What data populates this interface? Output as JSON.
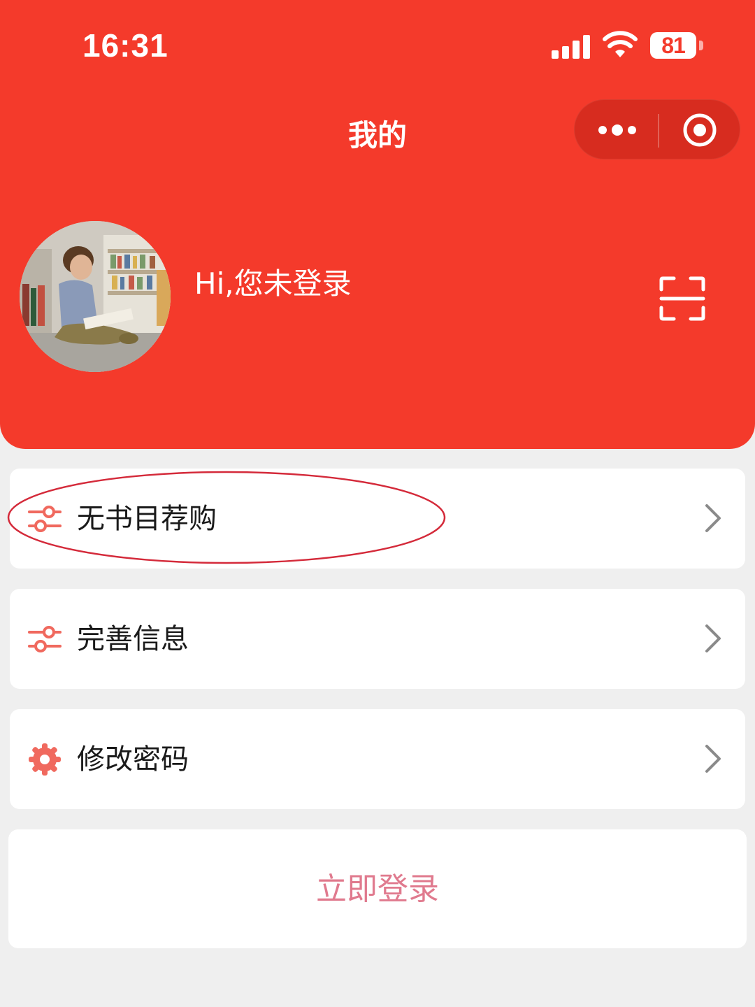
{
  "status_bar": {
    "time": "16:31",
    "battery": "81"
  },
  "nav": {
    "title": "我的",
    "more_icon": "more-dots-icon",
    "close_icon": "target-close-icon"
  },
  "profile": {
    "greeting": "Hi,您未登录",
    "avatar": "boy-reading-in-library",
    "scan_icon": "scan-icon"
  },
  "menu": [
    {
      "label": "无书目荐购",
      "icon": "sliders-icon"
    },
    {
      "label": "完善信息",
      "icon": "sliders-icon"
    },
    {
      "label": "修改密码",
      "icon": "gear-icon"
    }
  ],
  "login_button": {
    "label": "立即登录"
  },
  "colors": {
    "header_bg": "#f43a2b",
    "page_bg": "#efefef",
    "icon_accent": "#f0695e",
    "login_text": "#e07a8e",
    "annotation": "#d42a3a"
  }
}
